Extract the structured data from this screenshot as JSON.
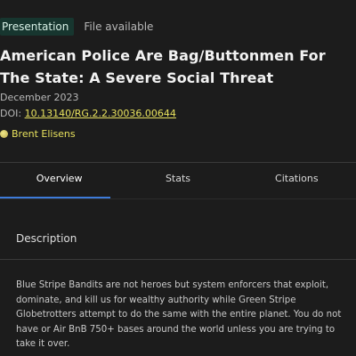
{
  "header": {
    "badge": "Presentation",
    "file_status": "File available",
    "title": "American Police Are Bag/Buttonmen For The State: A Severe Social Threat",
    "date": "December 2023",
    "doi_label": "DOI:",
    "doi_value": "10.13140/RG.2.2.30036.00644",
    "author": "Brent Elisens"
  },
  "tabs": [
    {
      "label": "Overview"
    },
    {
      "label": "Stats"
    },
    {
      "label": "Citations"
    }
  ],
  "section": {
    "title": "Description",
    "body": "Blue Stripe Bandits are not heroes but system enforcers that exploit, dominate, and kill us for wealthy authority while Green Stripe Globetrotters attempt to do the same with the entire planet. You do not have or Air BnB 750+ bases around the world unless you are trying to take it over."
  },
  "colors": {
    "background": "#1c1c1c",
    "badge_bg": "#17362f",
    "link": "#e7e15d",
    "tab_accent": "#3d7bd9"
  }
}
